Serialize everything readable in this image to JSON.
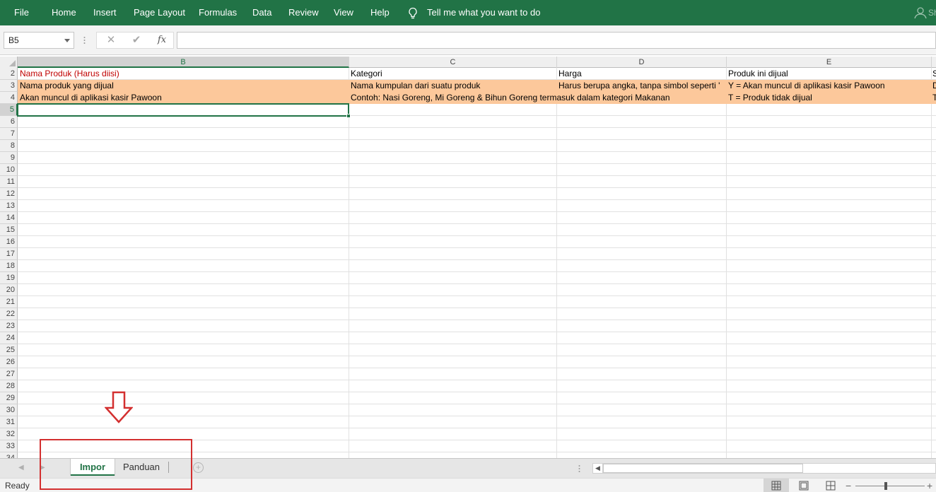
{
  "ribbon": {
    "tabs": [
      "File",
      "Home",
      "Insert",
      "Page Layout",
      "Formulas",
      "Data",
      "Review",
      "View",
      "Help"
    ],
    "tell_me": "Tell me what you want to do",
    "share_label": "Sh",
    "bulb_icon": "lightbulb-icon",
    "share_icon": "person-icon",
    "color": "#217346"
  },
  "formula_bar": {
    "name_box": "B5",
    "cancel_icon": "cancel-x-icon",
    "confirm_icon": "checkmark-icon",
    "fx_label": "fx",
    "formula_value": ""
  },
  "grid": {
    "columns": [
      "B",
      "C",
      "D",
      "E",
      "S"
    ],
    "active_column": "B",
    "row_numbers": [
      "2",
      "3",
      "4",
      "5",
      "6",
      "7",
      "8",
      "9",
      "10",
      "11",
      "12",
      "13",
      "14",
      "15",
      "16",
      "17",
      "18",
      "19",
      "20",
      "21",
      "22",
      "23",
      "24",
      "25",
      "26",
      "27",
      "28",
      "29",
      "30",
      "31",
      "32",
      "33",
      "34"
    ],
    "active_row": "5",
    "highlight_color": "#fcc89b",
    "rows": [
      {
        "row": "2",
        "cells": [
          "Nama Produk (Harus diisi)",
          "Kategori",
          "Harga",
          "Produk ini dijual",
          "S"
        ]
      },
      {
        "row": "3",
        "cells": [
          "Nama produk yang dijual",
          "Nama kumpulan dari suatu produk",
          "Harus berupa angka, tanpa simbol seperti '",
          "Y = Akan muncul di aplikasi kasir Pawoon",
          "D"
        ]
      },
      {
        "row": "4",
        "cells": [
          "Akan muncul di aplikasi kasir Pawoon",
          "Contoh: Nasi Goreng, Mi Goreng & Bihun Goreng termasuk dalam kategori Makanan",
          "",
          "T = Produk tidak dijual",
          "T"
        ]
      }
    ]
  },
  "sheets": {
    "tabs": [
      {
        "name": "Impor",
        "active": true
      },
      {
        "name": "Panduan",
        "active": false
      }
    ],
    "add_icon": "plus-circle-icon"
  },
  "status": {
    "text": "Ready",
    "views": [
      "normal-view-icon",
      "page-layout-view-icon",
      "page-break-view-icon"
    ],
    "zoom_minus": "−",
    "zoom_plus": "+"
  }
}
